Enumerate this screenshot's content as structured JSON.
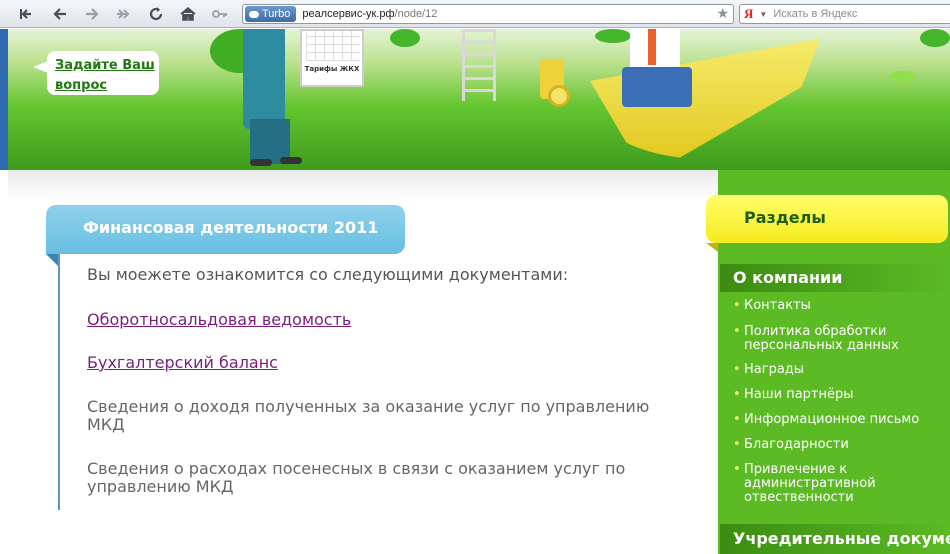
{
  "browser": {
    "turbo_label": "Turbo",
    "url_host": "реалсервис-ук.рф",
    "url_path": "/node/12",
    "search_logo": "Я",
    "search_placeholder": "Искать в Яндекс"
  },
  "header": {
    "ask_link": "Задайте Ваш вопрос",
    "sign_text": "Тарифы ЖКХ"
  },
  "main": {
    "title": "Финансовая деятельности 2011",
    "intro": "Вы моежете ознакомится со следующими документами:",
    "links": [
      "Оборотносальдовая ведомость",
      "Бухгалтерский баланс"
    ],
    "texts": [
      "Сведения о доходя полученных за оказание услуг по управлению МКД",
      "Сведения о расходах посенесных в связи с оказанием услуг по управлению МКД"
    ]
  },
  "sidebar": {
    "title": "Разделы",
    "category1": "О компании",
    "items": [
      "Контакты",
      "Политика обработки персональных данных",
      "Награды",
      "Наши партнёры",
      "Информационное письмо",
      "Благодарности",
      "Привлечение к административной отвественности"
    ],
    "category2": "Учредительные документы"
  },
  "colors": {
    "link_visited": "#7a1d7e",
    "title_tab": "#66bfe2",
    "sidebar_green": "#5cba24",
    "sidebar_yellow": "#f6ea1f"
  }
}
